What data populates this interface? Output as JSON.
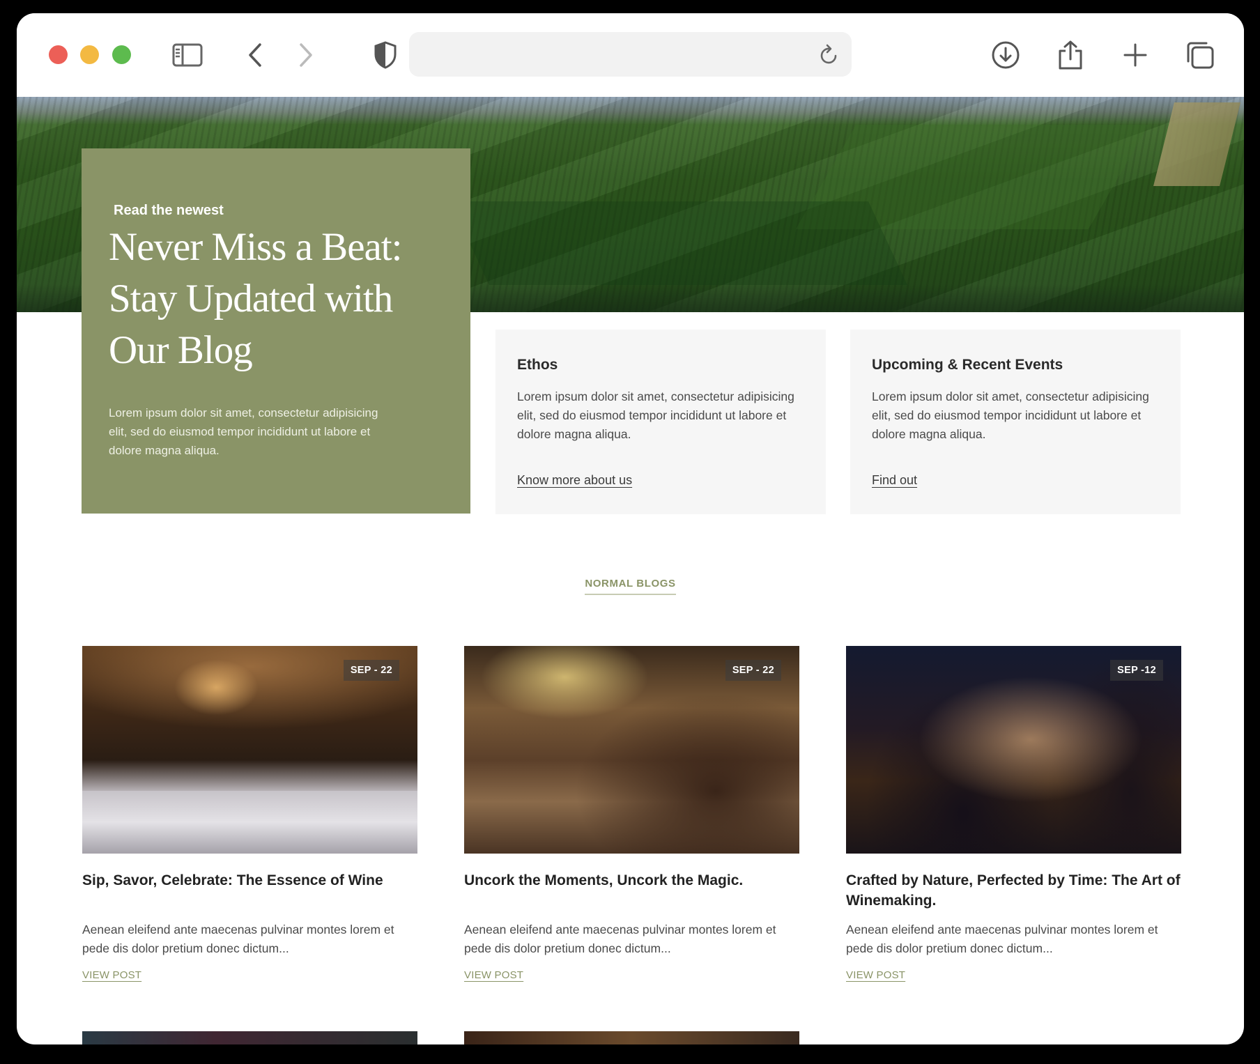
{
  "browser": {
    "icons": {
      "sidebar": "sidebar-icon",
      "back": "chevron-left-icon",
      "forward": "chevron-right-icon",
      "privacy": "shield-icon",
      "reload": "reload-icon",
      "download": "download-icon",
      "share": "share-icon",
      "new_tab": "plus-icon",
      "tabs": "tabs-overview-icon"
    },
    "address_value": ""
  },
  "hero": {
    "kicker": "Read the newest",
    "headline": "Never Miss a Beat: Stay Updated with Our Blog",
    "description": "Lorem ipsum dolor sit amet, consectetur adipisicing elit, sed do eiusmod tempor incididunt ut labore et dolore magna aliqua."
  },
  "cards": [
    {
      "title": "Ethos",
      "body": "Lorem ipsum dolor sit amet, consectetur adipisicing elit, sed do eiusmod tempor incididunt ut labore et dolore magna aliqua.",
      "link": "Know more about us"
    },
    {
      "title": "Upcoming & Recent Events",
      "body": "Lorem ipsum dolor sit amet, consectetur adipisicing elit, sed do eiusmod tempor incididunt ut labore et dolore magna aliqua.",
      "link": "Find out"
    }
  ],
  "section_label": "NORMAL BLOGS",
  "posts": [
    {
      "date": "SEP - 22",
      "title": "Sip, Savor, Celebrate: The Essence of Wine",
      "excerpt": "Aenean eleifend ante maecenas pulvinar montes lorem et pede dis dolor pretium donec dictum...",
      "link": "VIEW POST"
    },
    {
      "date": "SEP - 22",
      "title": "Uncork the Moments, Uncork the Magic.",
      "excerpt": "Aenean eleifend ante maecenas pulvinar montes lorem et pede dis dolor pretium donec dictum...",
      "link": "VIEW POST"
    },
    {
      "date": "SEP -12",
      "title": "Crafted by Nature, Perfected by Time: The Art of Winemaking.",
      "excerpt": "Aenean eleifend ante maecenas pulvinar montes lorem et pede dis dolor pretium donec dictum...",
      "link": "VIEW POST"
    }
  ],
  "colors": {
    "accent_green": "#8a9467",
    "card_bg": "#f6f6f6",
    "close": "#ec5f57",
    "minimize": "#f3b942",
    "zoom": "#5dbb4e"
  }
}
